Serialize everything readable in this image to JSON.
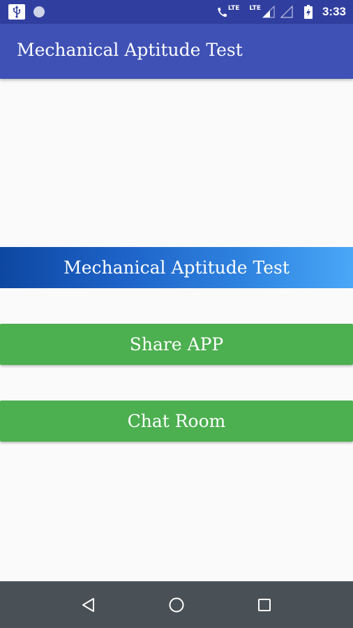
{
  "status_bar": {
    "icons": [
      "usb-icon",
      "notification-dot-icon",
      "volte-call-icon",
      "signal-icon",
      "signal-empty-icon",
      "battery-charging-icon"
    ],
    "network_label_1": "LTE",
    "network_label_2": "LTE",
    "time": "3:33"
  },
  "app_bar": {
    "title": "Mechanical Aptitude Test",
    "color": "#3f51b5"
  },
  "main": {
    "primary_button_label": "Mechanical Aptitude Test",
    "share_button_label": "Share APP",
    "chat_button_label": "Chat Room",
    "green_color": "#4caf50",
    "gradient_start_color": "#0d47a1",
    "gradient_end_color": "#4aa7f7"
  },
  "nav_bar": {
    "icons": [
      "back-icon",
      "home-icon",
      "recent-apps-icon"
    ]
  }
}
